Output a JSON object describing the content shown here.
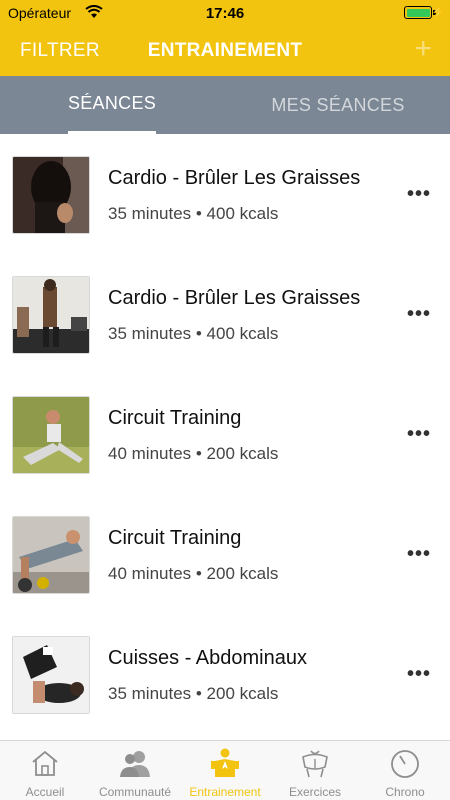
{
  "status_bar": {
    "carrier": "Opérateur",
    "time": "17:46"
  },
  "nav": {
    "filter_label": "FILTRER",
    "title": "ENTRAINEMENT"
  },
  "segment_tabs": [
    {
      "label": "SÉANCES",
      "selected": true
    },
    {
      "label": "MES SÉANCES",
      "selected": false
    }
  ],
  "sessions": [
    {
      "name": "Cardio - Brûler Les Graisses",
      "meta": "35 minutes • 400 kcals"
    },
    {
      "name": "Cardio - Brûler Les Graisses",
      "meta": "35 minutes • 400 kcals"
    },
    {
      "name": "Circuit Training",
      "meta": "40 minutes • 200 kcals"
    },
    {
      "name": "Circuit Training",
      "meta": "40 minutes • 200 kcals"
    },
    {
      "name": "Cuisses - Abdominaux",
      "meta": "35 minutes • 200 kcals"
    }
  ],
  "more_label": "•••",
  "tab_bar": [
    {
      "label": "Accueil",
      "icon": "home-icon"
    },
    {
      "label": "Communauté",
      "icon": "community-icon"
    },
    {
      "label": "Entrainement",
      "icon": "training-icon",
      "active": true
    },
    {
      "label": "Exercices",
      "icon": "exercises-icon"
    },
    {
      "label": "Chrono",
      "icon": "stopwatch-icon"
    }
  ],
  "colors": {
    "accent": "#f2c40f",
    "segment_bg": "#7b8794",
    "battery": "#34c759"
  }
}
